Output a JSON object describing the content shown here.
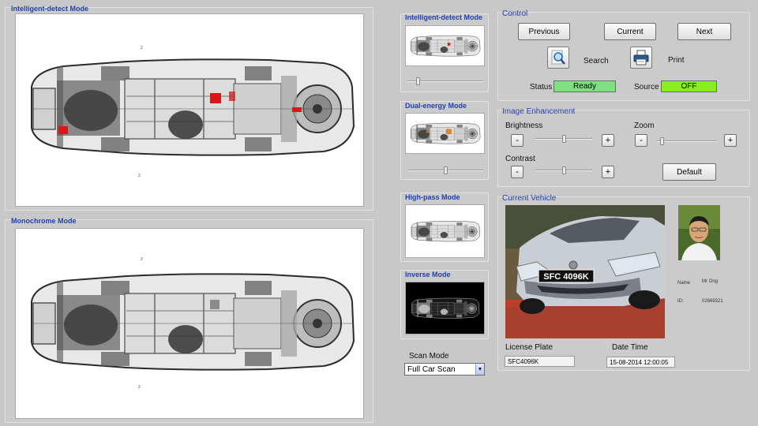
{
  "panels": {
    "intelligent_main": "Intelligent-detect Mode",
    "monochrome_main": "Monochrome Mode"
  },
  "thumbnails": [
    {
      "title": "Intelligent-detect Mode",
      "slider": 0.12
    },
    {
      "title": "Dual-energy Mode",
      "slider": 0.5
    },
    {
      "title": "High-pass Mode"
    },
    {
      "title": "Inverse Mode"
    }
  ],
  "scan_mode": {
    "label": "Scan Mode",
    "value": "Full Car Scan"
  },
  "control": {
    "title": "Control",
    "previous": "Previous",
    "current": "Current",
    "next": "Next",
    "search": "Search",
    "print": "Print",
    "status_label": "Status",
    "status_value": "Ready",
    "source_label": "Source",
    "source_value": "OFF",
    "status_color": "#7ee07e",
    "source_color": "#88ee22"
  },
  "enhancement": {
    "title": "Image Enhancement",
    "brightness": "Brightness",
    "zoom": "Zoom",
    "contrast": "Contrast",
    "default": "Default",
    "minus": "-",
    "plus": "+",
    "brightness_level": 0.5,
    "zoom_level": 0.05,
    "contrast_level": 0.5
  },
  "vehicle": {
    "title": "Current Vehicle",
    "plate_on_car": "SFC 4096K",
    "name_label": "Name",
    "name_value": "Mr Ong",
    "id_label": "ID:",
    "id_value": "02669321",
    "license_plate_label": "License Plate",
    "license_plate_value": "SFC4096K",
    "date_time_label": "Date Time",
    "date_time_value": "15-08-2014 12:00:05"
  },
  "colors": {
    "title_blue": "#1f3fb0",
    "threat_red": "#d81818",
    "accent_orange": "#e07a18"
  }
}
